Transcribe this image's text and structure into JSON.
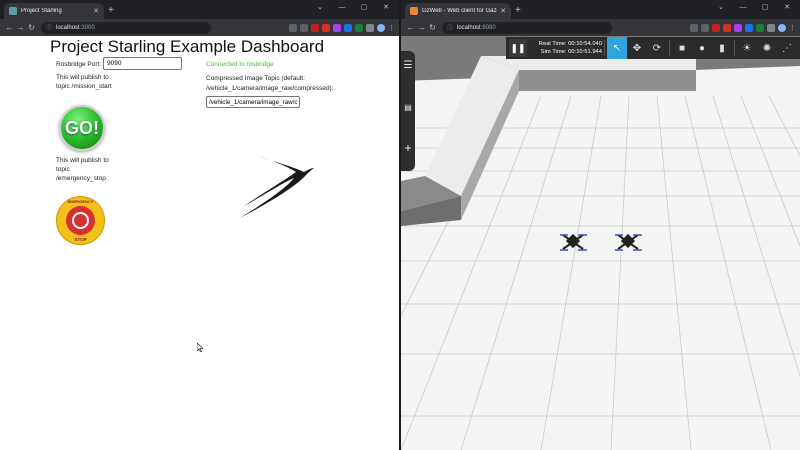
{
  "left_window": {
    "tab_title": "Project Starling",
    "favicon_color": "#5f9ea0",
    "new_tab_glyph": "+",
    "url_host": "localhost",
    "url_port": ":3000",
    "page": {
      "title": "Project Starling Example Dashboard",
      "rosbridge_port_label": "Rosbridge Port:",
      "rosbridge_port_value": "9090",
      "mission_note_line1": "This will publish to",
      "mission_note_line2": "topic /mission_start",
      "go_button_label": "GO!",
      "emergency_note_line1": "This will publish to",
      "emergency_note_line2": "topic",
      "emergency_note_line3": "/emergency_stop",
      "emergency_badge_top": "EMERGENCY",
      "emergency_badge_bottom": "STOP",
      "connection_status": "Connected to rosbridge",
      "connection_color": "#3cc23c",
      "image_topic_label_line1": "Compressed Image Topic (default:",
      "image_topic_label_line2": "/vehicle_1/camera/image_raw/compressed):",
      "image_topic_value": "/vehicle_1/camera/image_raw/compressed"
    }
  },
  "right_window": {
    "tab_title": "GzWeb - Web client for Gazebo",
    "favicon_color": "#e58a2e",
    "new_tab_glyph": "+",
    "url_host": "localhost",
    "url_port": ":8080",
    "gazebo": {
      "real_time_label": "Real Time:",
      "real_time_value": "00:10:54.040",
      "sim_time_label": "Sim Time:",
      "sim_time_value": "00:10:51.944",
      "active_tool": "select-arrow",
      "accent": "#2fa4de"
    }
  },
  "icons": {
    "back": "back-arrow-icon",
    "forward": "forward-arrow-icon",
    "reload": "reload-icon",
    "lock": "info-icon",
    "menu": "hamburger-icon",
    "add": "plus-icon"
  }
}
